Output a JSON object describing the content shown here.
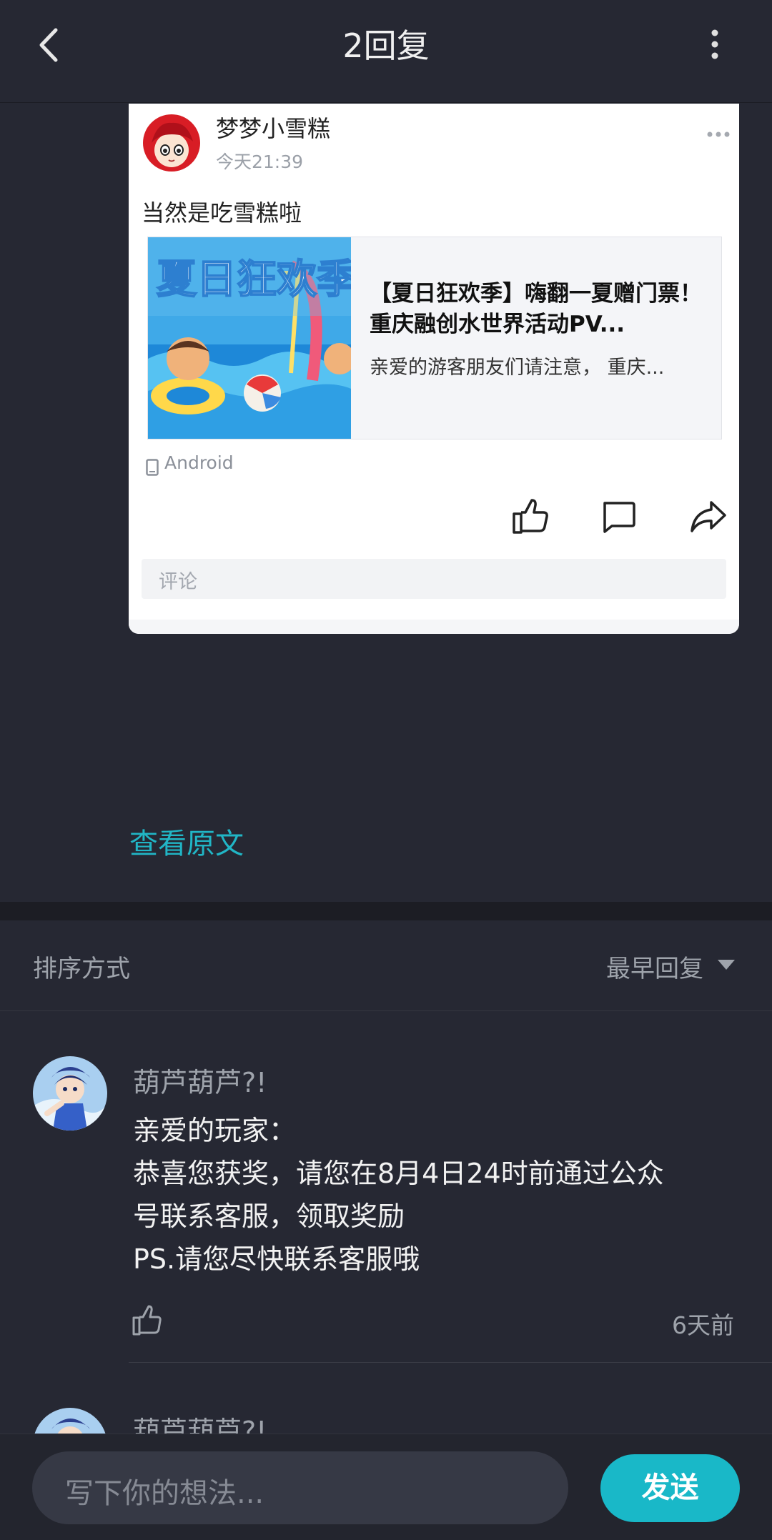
{
  "header": {
    "title": "2回复",
    "back_icon": "chevron-left-icon",
    "more_icon": "vertical-dots-icon"
  },
  "post": {
    "author": "梦梦小雪糕",
    "time": "今天21:39",
    "text": "当然是吃雪糕啦",
    "link": {
      "title": "【夏日狂欢季】嗨翻一夏赠门票！重庆融创水世界活动PV...",
      "desc": "亲爱的游客朋友们请注意， 重庆...",
      "thumb_text": "夏日狂欢季"
    },
    "device": "Android",
    "comment_placeholder": "评论"
  },
  "view_original": "查看原文",
  "sort": {
    "label": "排序方式",
    "value": "最早回复"
  },
  "replies": [
    {
      "user": "葫芦葫芦?!",
      "lines": [
        "亲爱的玩家：",
        "恭喜您获奖，请您在8月4日24时前通过公众",
        "号联系客服，领取奖励",
        "PS.请您尽快联系客服哦"
      ],
      "time": "6天前"
    },
    {
      "user": "葫芦葫芦?!"
    }
  ],
  "input": {
    "placeholder": "写下你的想法...",
    "send": "发送"
  },
  "colors": {
    "background": "#262833",
    "accent": "#19b8c8",
    "link": "#21b6c6"
  }
}
